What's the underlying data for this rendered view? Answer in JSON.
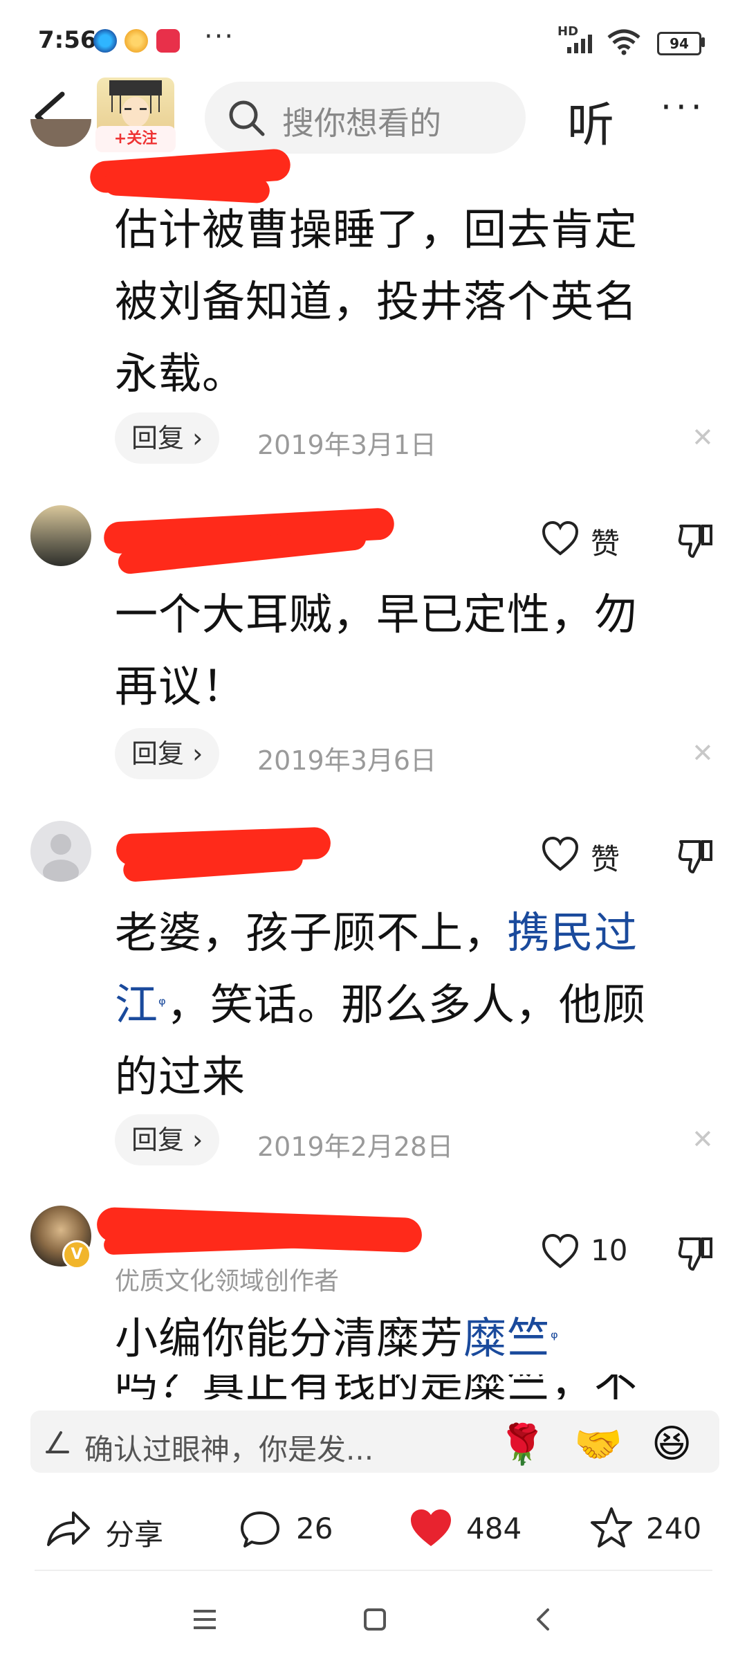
{
  "status_bar": {
    "time": "7:56",
    "network": "HD",
    "battery": "94",
    "more_dots": "···"
  },
  "header": {
    "follow_label": "+关注",
    "search_placeholder": "搜你想看的",
    "listen_label": "听",
    "more_label": "···"
  },
  "comments": [
    {
      "text_lines": [
        "估计被曹操睡了，回去肯定",
        "被刘备知道，投井落个英名",
        "永载。"
      ],
      "reply_label": "回复",
      "date": "2019年3月1日"
    },
    {
      "like_label": "赞",
      "text_lines": [
        "一个大耳贼，早已定性，勿",
        "再议！"
      ],
      "reply_label": "回复",
      "date": "2019年3月6日"
    },
    {
      "like_label": "赞",
      "line1_plain": "老婆，孩子顾不上，",
      "line1_link": "携民过",
      "line2_link": "江",
      "line2_plain": "，笑话。那么多人，他顾",
      "line3": "的过来",
      "reply_label": "回复",
      "date": "2019年2月28日"
    },
    {
      "like_count": "10",
      "author_tag": "优质文化领域创作者",
      "line1_plain": "小编你能分清糜芳",
      "line1_link": "糜竺",
      "line2_partial": "吗？真正有钱的是糜竺，不"
    }
  ],
  "input": {
    "placeholder": "确认过眼神，你是发..."
  },
  "actions": {
    "share_label": "分享",
    "comments_count": "26",
    "likes_count": "484",
    "favorites_count": "240"
  },
  "colors": {
    "like_heart": "#e8232f",
    "link": "#1a4a9c",
    "redaction": "#ff2a1a"
  }
}
